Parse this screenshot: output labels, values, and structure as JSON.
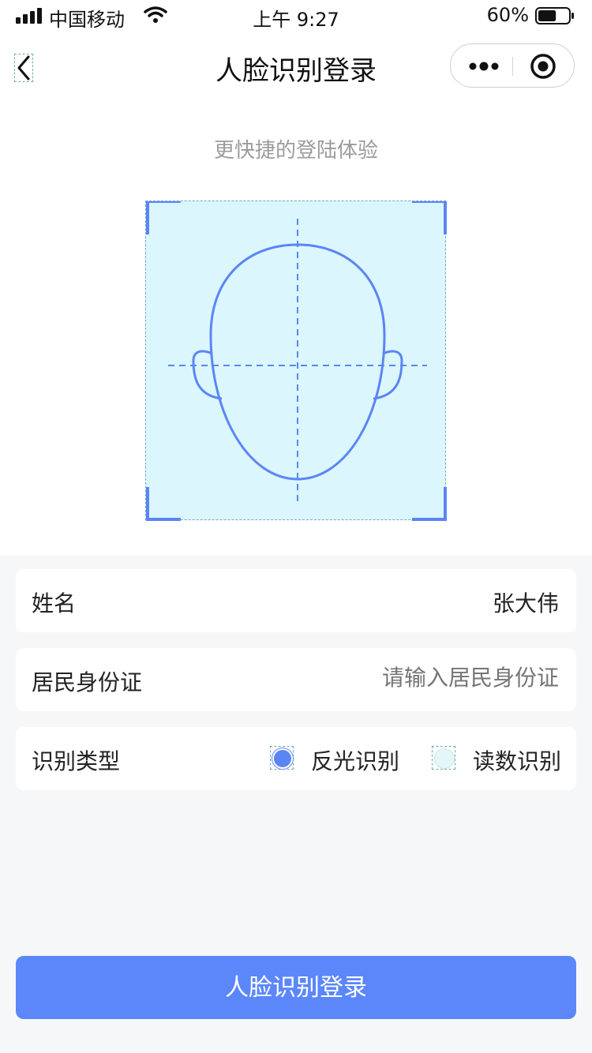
{
  "status_bar": {
    "carrier": "中国移动",
    "time": "上午 9:27",
    "battery": "60%",
    "battery_level": 0.6,
    "icons": [
      "signal-icon",
      "wifi-icon",
      "battery-icon"
    ]
  },
  "nav": {
    "title": "人脸识别登录",
    "back_icon": "chevron-left-icon",
    "capsule_icons": [
      "more-dots-icon",
      "close-target-icon"
    ]
  },
  "subtitle": "更快捷的登陆体验",
  "face_frame": {
    "icon": "face-outline-icon",
    "accent": "#5b85f5",
    "background": "#dbf6fc"
  },
  "form": {
    "name": {
      "label": "姓名",
      "value": "张大伟"
    },
    "id_card": {
      "label": "居民身份证",
      "placeholder": "请输入居民身份证"
    },
    "recognition_type": {
      "label": "识别类型",
      "options": [
        {
          "label": "反光识别",
          "selected": true
        },
        {
          "label": "读数识别",
          "selected": false
        }
      ]
    }
  },
  "submit_label": "人脸识别登录",
  "colors": {
    "accent": "#5b87fb",
    "page_bg": "#f6f7f9",
    "placeholder": "#a6a6a6",
    "subtitle": "#9b9b9b"
  }
}
